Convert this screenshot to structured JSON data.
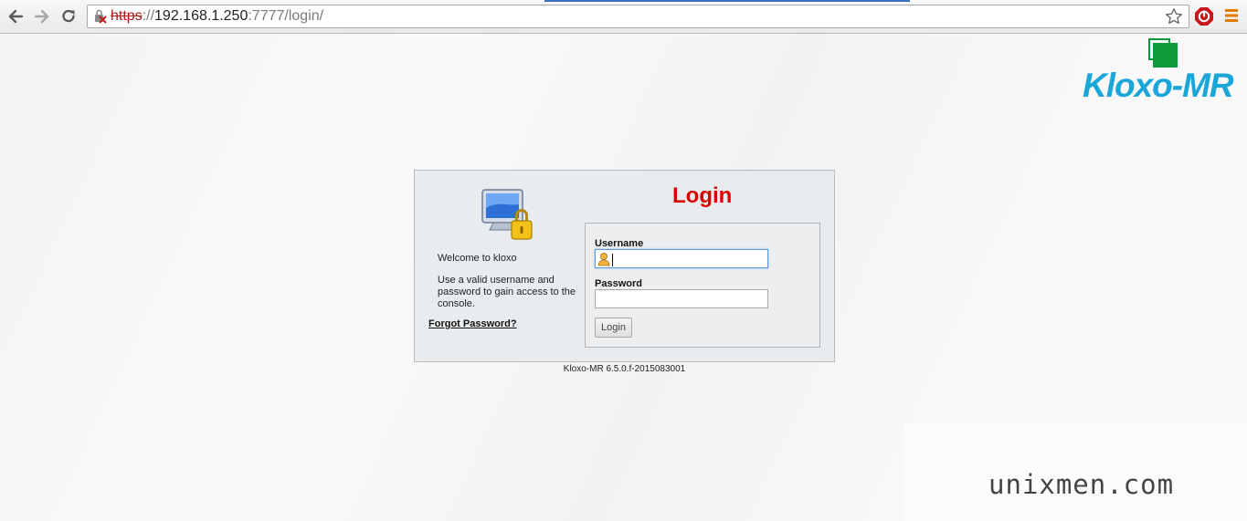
{
  "browser": {
    "url_scheme": "https",
    "url_sep": "://",
    "url_host": "192.168.1.250",
    "url_port_path": ":7777/login/",
    "icons": {
      "back": "back-arrow-icon",
      "forward": "forward-arrow-icon",
      "reload": "reload-icon",
      "security": "broken-lock-icon",
      "bookmark": "star-icon",
      "extension": "stop-sign-icon",
      "menu": "hamburger-menu-icon"
    },
    "accent_color": "#3a6fc4"
  },
  "logo": {
    "text": "Kloxo-MR",
    "text_color": "#1aa6d8",
    "mark_color": "#0c9a3a"
  },
  "login": {
    "title": "Login",
    "title_color": "#d90000",
    "welcome": "Welcome to kloxo",
    "help": "Use a valid username and password to gain access to the console.",
    "forgot_link": "Forgot Password?",
    "username_label": "Username",
    "username_value": "",
    "password_label": "Password",
    "password_value": "",
    "submit_label": "Login",
    "icon": "monitor-lock-icon"
  },
  "footer": {
    "version": "Kloxo-MR 6.5.0.f-2015083001"
  },
  "watermark": {
    "text": "unixmen.com"
  }
}
